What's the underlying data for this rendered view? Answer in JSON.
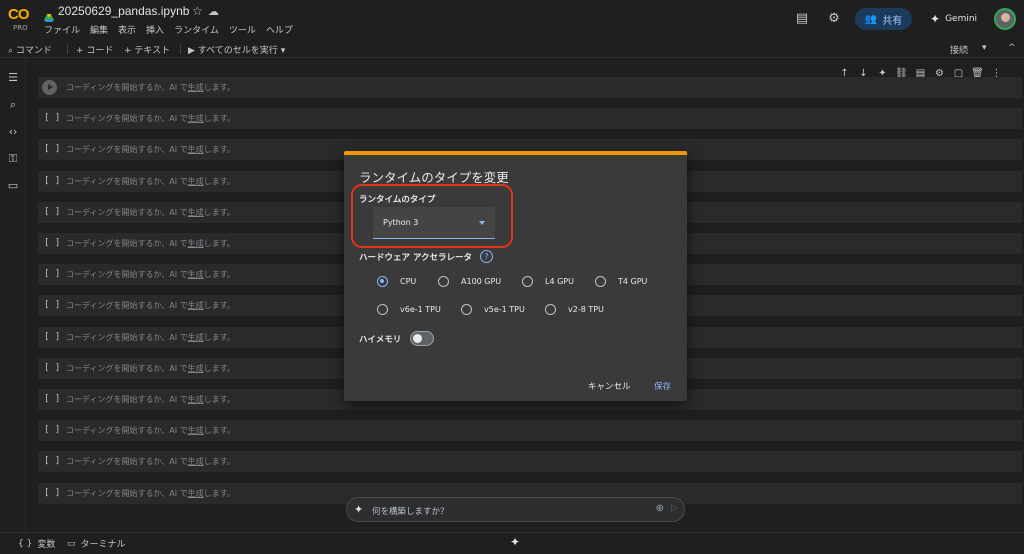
{
  "header": {
    "logo_text": "CO",
    "logo_badge": "PRO",
    "filename": "20250629_pandas.ipynb",
    "menu": [
      "ファイル",
      "編集",
      "表示",
      "挿入",
      "ランタイム",
      "ツール",
      "ヘルプ"
    ],
    "share_label": "共有",
    "gemini_label": "Gemini"
  },
  "toolbar": {
    "command_label": "コマンド",
    "code_label": "+ コード",
    "text_label": "+ テキスト",
    "run_all_label": "すべてのセルを実行",
    "connect_label": "接続"
  },
  "cells": {
    "placeholder_prefix": "コーディングを開始するか、AI で",
    "placeholder_link": "生成",
    "placeholder_suffix": "します。",
    "bracket": "[ ]",
    "count": 14
  },
  "dialog": {
    "title": "ランタイムのタイプを変更",
    "runtime_type_label": "ランタイムのタイプ",
    "runtime_type_value": "Python 3",
    "accelerator_label": "ハードウェア アクセラレータ",
    "help_glyph": "?",
    "accelerators": [
      {
        "label": "CPU",
        "selected": true
      },
      {
        "label": "A100 GPU",
        "selected": false
      },
      {
        "label": "L4 GPU",
        "selected": false
      },
      {
        "label": "T4 GPU",
        "selected": false
      },
      {
        "label": "v6e-1 TPU",
        "selected": false
      },
      {
        "label": "v5e-1 TPU",
        "selected": false
      },
      {
        "label": "v2-8 TPU",
        "selected": false
      }
    ],
    "high_memory_label": "ハイメモリ",
    "high_memory_on": false,
    "cancel_label": "キャンセル",
    "save_label": "保存",
    "accent_color": "#f29900",
    "highlight_color": "#e8331b"
  },
  "prompt": {
    "placeholder": "何を構築しますか？"
  },
  "bottom": {
    "variables_label": "変数",
    "terminal_label": "ターミナル"
  }
}
